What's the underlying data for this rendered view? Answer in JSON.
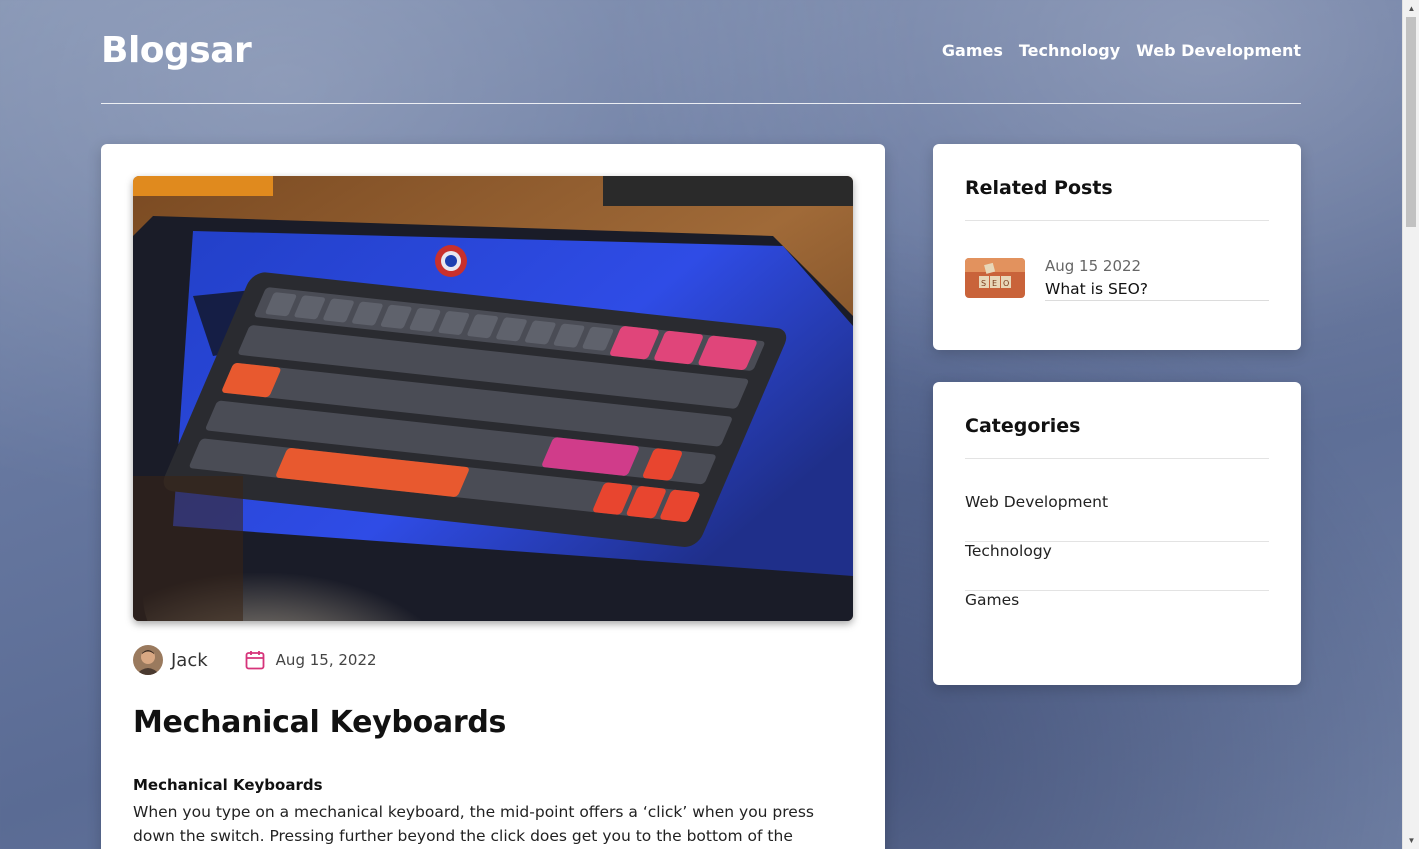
{
  "header": {
    "logo": "Blogsar",
    "nav": [
      "Games",
      "Technology",
      "Web Development"
    ]
  },
  "post": {
    "image_alt": "mechanical-keyboard-photo",
    "author": "Jack",
    "date": "Aug 15, 2022",
    "title": "Mechanical Keyboards",
    "subheading": "Mechanical Keyboards",
    "body_lines": [
      "When you type on a mechanical keyboard, the mid-point offers a ‘click’ when you press",
      "down the switch. Pressing further beyond the click does get you to the bottom of the"
    ]
  },
  "related": {
    "title": "Related Posts",
    "items": [
      {
        "date": "Aug 15 2022",
        "title": "What is SEO?"
      }
    ]
  },
  "categories": {
    "title": "Categories",
    "items": [
      "Web Development",
      "Technology",
      "Games"
    ]
  },
  "colors": {
    "accent": "#d6337a",
    "text": "#111111",
    "card": "#ffffff"
  }
}
